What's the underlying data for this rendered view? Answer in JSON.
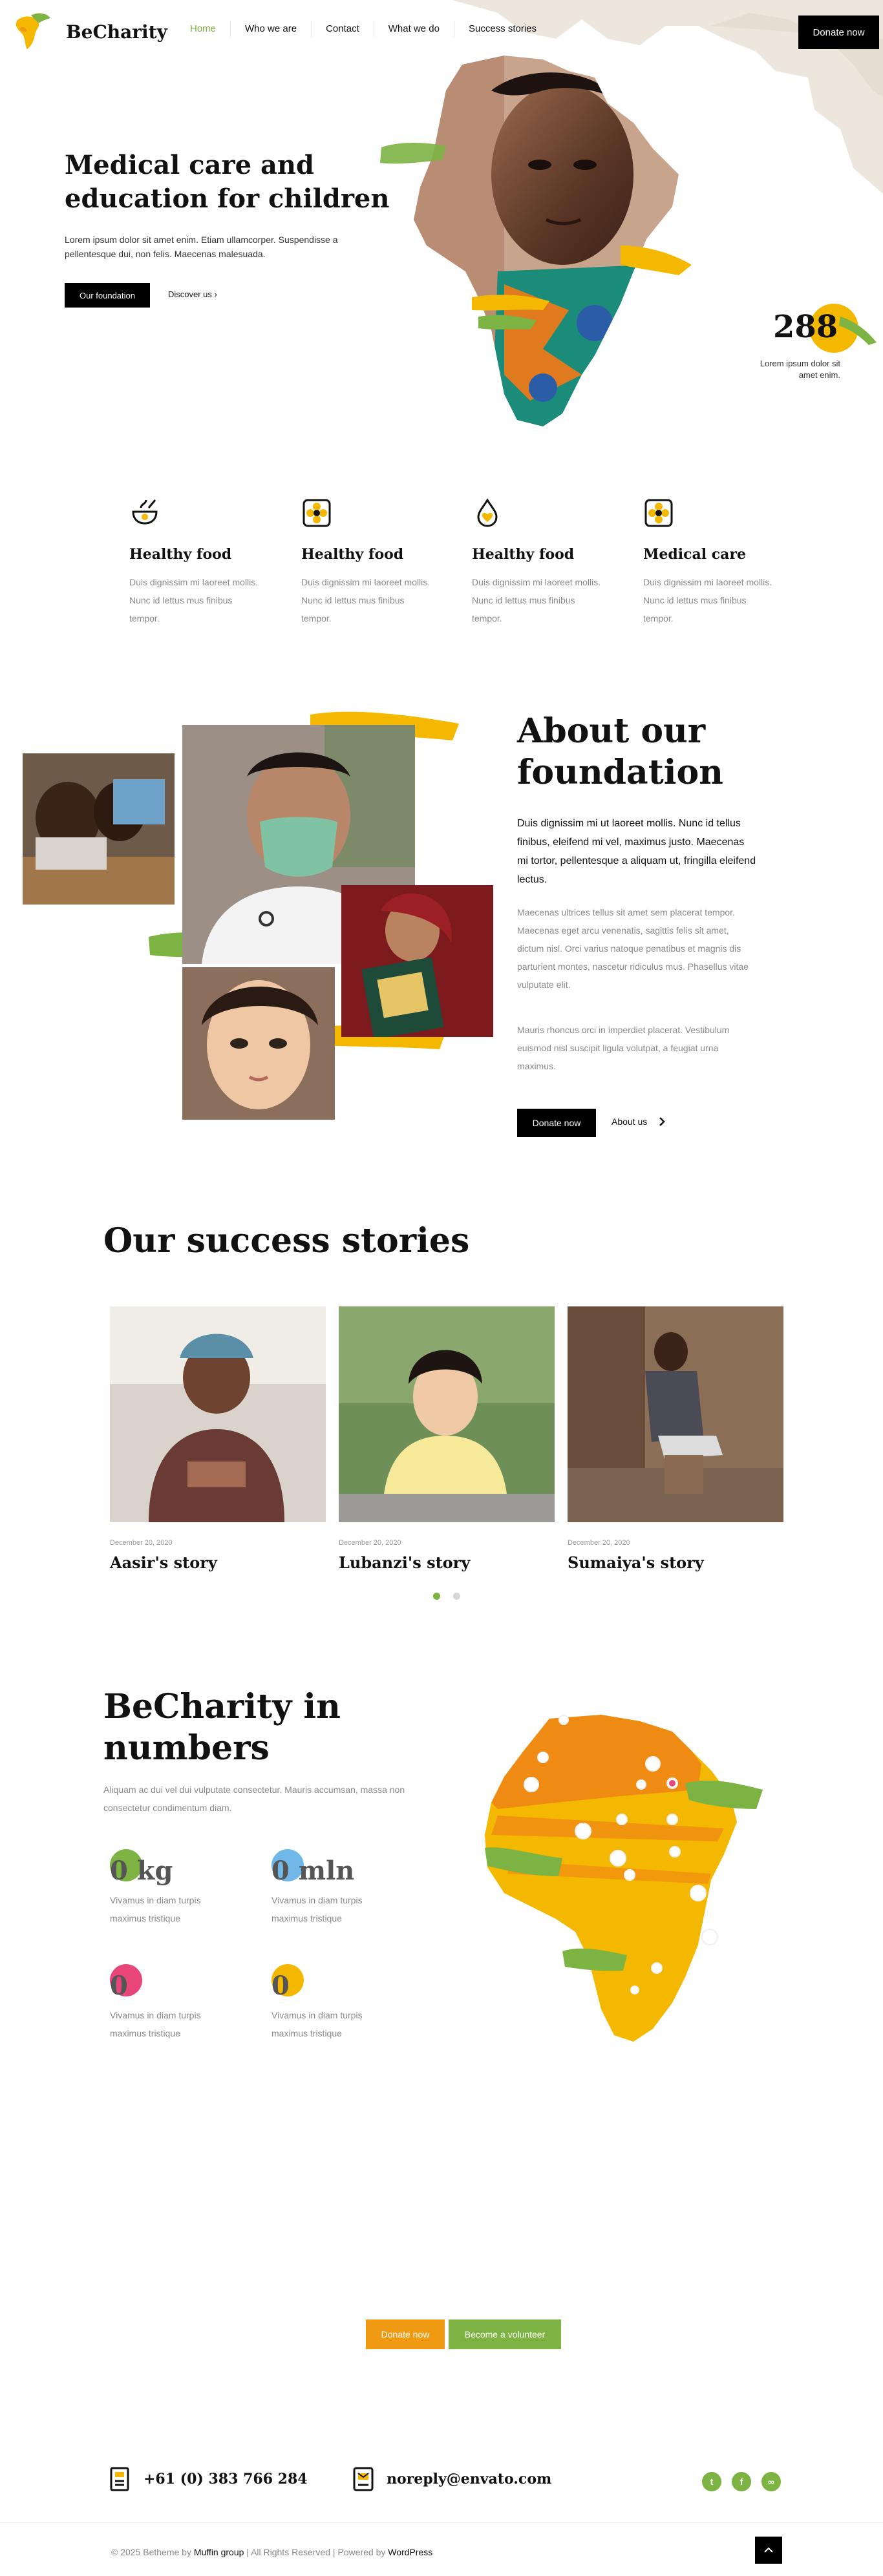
{
  "brand": {
    "name": "BeCharity"
  },
  "nav": {
    "items": [
      "Home",
      "Who we are",
      "Contact",
      "What we do",
      "Success stories"
    ],
    "active": "Home"
  },
  "header": {
    "donate_label": "Donate now"
  },
  "hero": {
    "title_line1": "Medical care and",
    "title_line2": "education for children",
    "text": "Lorem ipsum dolor sit amet enim. Etiam ullamcorper. Suspendisse a pellentesque dui, non felis. Maecenas malesuada.",
    "button_label": "Our foundation",
    "link_label": "Discover us",
    "stat_value": "288",
    "stat_text": "Lorem ipsum dolor sit amet enim."
  },
  "features": [
    {
      "icon": "food-bowl-icon",
      "title": "Healthy food",
      "text": "Duis dignissim mi laoreet mollis. Nunc id lettus mus finibus tempor."
    },
    {
      "icon": "flower-badge-icon",
      "title": "Healthy food",
      "text": "Duis dignissim mi laoreet mollis. Nunc id lettus mus finibus tempor."
    },
    {
      "icon": "drop-heart-icon",
      "title": "Healthy food",
      "text": "Duis dignissim mi laoreet mollis. Nunc id lettus mus finibus tempor."
    },
    {
      "icon": "flower-badge-icon",
      "title": "Medical care",
      "text": "Duis dignissim mi laoreet mollis. Nunc id lettus mus finibus tempor."
    }
  ],
  "about": {
    "title_line1": "About our",
    "title_line2": "foundation",
    "lead": "Duis dignissim mi ut laoreet mollis. Nunc id tellus finibus, eleifend mi vel, maximus justo. Maecenas mi tortor, pellentesque a aliquam ut, fringilla eleifend lectus.",
    "paragraph1": "Maecenas ultrices tellus sit amet sem placerat tempor. Maecenas eget arcu venenatis, sagittis felis sit amet, dictum nisl. Orci varius natoque penatibus et magnis dis parturient montes, nascetur ridiculus mus. Phasellus vitae vulputate elit.",
    "paragraph2": "Mauris rhoncus orci in imperdiet placerat. Vestibulum euismod nisl suscipit ligula volutpat, a feugiat urna maximus.",
    "button_label": "Donate now",
    "link_label": "About us"
  },
  "stories": {
    "title": "Our success stories",
    "items": [
      {
        "date": "December 20, 2020",
        "name": "Aasir's story"
      },
      {
        "date": "December 20, 2020",
        "name": "Lubanzi's story"
      },
      {
        "date": "December 20, 2020",
        "name": "Sumaiya's story"
      }
    ],
    "active_dot": 0,
    "dot_count": 2
  },
  "numbers": {
    "title_line1": "BeCharity in",
    "title_line2": "numbers",
    "text": "Aliquam ac dui vel dui vulputate consectetur. Mauris accumsan, massa non consectetur condimentum diam.",
    "items": [
      {
        "value": "0 kg",
        "caption": "Vivamus in diam turpis maximus tristique",
        "color": "#7cb342"
      },
      {
        "value": "0 mln",
        "caption": "Vivamus in diam turpis maximus tristique",
        "color": "#6fb8e8"
      },
      {
        "value": "0",
        "caption": "Vivamus in diam turpis maximus tristique",
        "color": "#e8457a"
      },
      {
        "value": "0",
        "caption": "Vivamus in diam turpis maximus tristique",
        "color": "#f5b800"
      }
    ]
  },
  "cta": {
    "donate_label": "Donate now",
    "volunteer_label": "Become a volunteer"
  },
  "contact": {
    "phone": "+61 (0) 383 766 284",
    "email": "noreply@envato.com"
  },
  "social": [
    "twitter-icon",
    "facebook-icon",
    "tripadvisor-icon"
  ],
  "footer": {
    "prefix": "© 2025 Betheme by ",
    "company": "Muffin group",
    "middle": " | All Rights Reserved | Powered by ",
    "platform": "WordPress"
  },
  "colors": {
    "accent_green": "#7cb342",
    "accent_orange": "#ef9a12",
    "accent_yellow": "#f5b800",
    "black": "#000000"
  }
}
